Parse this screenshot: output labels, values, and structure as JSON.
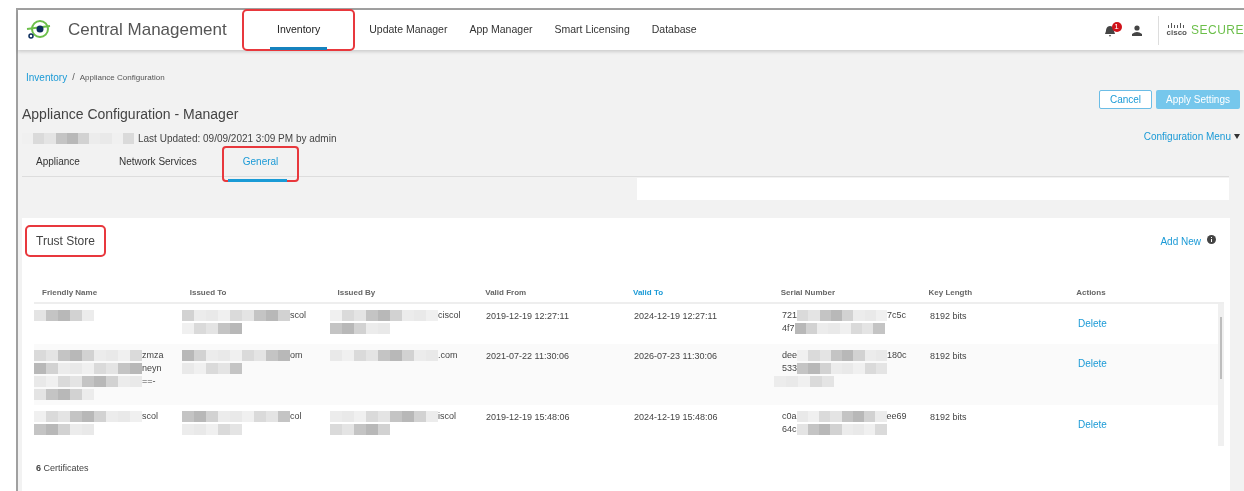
{
  "app": {
    "title": "Central Management",
    "brand_mark": "cisco",
    "brand_name": "SECURE"
  },
  "nav": [
    {
      "label": "Inventory",
      "selected": true,
      "highlighted": true
    },
    {
      "label": "Update Manager",
      "selected": false,
      "highlighted": false
    },
    {
      "label": "App Manager",
      "selected": false,
      "highlighted": false
    },
    {
      "label": "Smart Licensing",
      "selected": false,
      "highlighted": false
    },
    {
      "label": "Database",
      "selected": false,
      "highlighted": false
    }
  ],
  "notifications": {
    "badge": "1"
  },
  "breadcrumb": [
    "Inventory",
    "Appliance Configuration"
  ],
  "breadcrumb_separator": "/",
  "page": {
    "title": "Appliance Configuration - Manager",
    "subtitle": {
      "redacted": true,
      "text": "Last Updated: 09/09/2021 3:09 PM by admin"
    }
  },
  "buttons": {
    "cancel": "Cancel",
    "apply": "Apply Settings",
    "menu": "Configuration Menu"
  },
  "tabs": [
    {
      "label": "Appliance",
      "selected": false,
      "highlighted": false
    },
    {
      "label": "Network Services",
      "selected": false,
      "highlighted": false
    },
    {
      "label": "General",
      "selected": true,
      "highlighted": true
    }
  ],
  "trust_store": {
    "title": "Trust Store",
    "title_highlighted": true,
    "add_new": "Add New",
    "columns": [
      {
        "label": "Friendly Name",
        "sorted": false
      },
      {
        "label": "Issued To",
        "sorted": false
      },
      {
        "label": "Issued By",
        "sorted": false
      },
      {
        "label": "Valid From",
        "sorted": false
      },
      {
        "label": "Valid To",
        "sorted": true
      },
      {
        "label": "Serial Number",
        "sorted": false
      },
      {
        "label": "Key Length",
        "sorted": false
      },
      {
        "label": "Actions",
        "sorted": false
      }
    ],
    "rows": [
      {
        "cells": [
          {
            "lines": [
              {
                "redacted": true
              }
            ]
          },
          {
            "lines": [
              {
                "redacted": true,
                "after": "scol"
              },
              {
                "redacted": true
              }
            ]
          },
          {
            "lines": [
              {
                "redacted": true,
                "after": "ciscol"
              },
              {
                "redacted": true
              }
            ]
          },
          "2019-12-19 12:27:11",
          "2024-12-19 12:27:11",
          {
            "lines": [
              {
                "before": "721",
                "redacted": true,
                "after": "7c5c"
              },
              {
                "before": "4f7",
                "redacted": true
              }
            ]
          },
          "8192 bits"
        ],
        "action": "Delete"
      },
      {
        "cells": [
          {
            "lines": [
              {
                "redacted": true,
                "after": "zmza"
              },
              {
                "redacted": true,
                "after": "neyn"
              },
              {
                "redacted": true,
                "after": "==-"
              },
              {
                "redacted": true
              }
            ]
          },
          {
            "lines": [
              {
                "redacted": true,
                "after": "om"
              },
              {
                "redacted": true
              }
            ]
          },
          {
            "lines": [
              {
                "redacted": true,
                "after": ".com"
              }
            ]
          },
          "2021-07-22 11:30:06",
          "2026-07-23 11:30:06",
          {
            "lines": [
              {
                "before": "dee",
                "redacted": true,
                "after": "180c"
              },
              {
                "before": "533",
                "redacted": true
              },
              {
                "redacted": true
              }
            ]
          },
          "8192 bits"
        ],
        "action": "Delete"
      },
      {
        "cells": [
          {
            "lines": [
              {
                "redacted": true,
                "after": "scol"
              },
              {
                "redacted": true
              }
            ]
          },
          {
            "lines": [
              {
                "redacted": true,
                "after": "col"
              },
              {
                "redacted": true
              }
            ]
          },
          {
            "lines": [
              {
                "redacted": true,
                "after": "iscol"
              },
              {
                "redacted": true
              }
            ]
          },
          "2019-12-19 15:48:06",
          "2024-12-19 15:48:06",
          {
            "lines": [
              {
                "before": "c0a",
                "redacted": true,
                "after": "ee69"
              },
              {
                "before": "64c",
                "redacted": true
              }
            ]
          },
          "8192 bits"
        ],
        "action": "Delete"
      }
    ],
    "footer_count": "6",
    "footer_label": "Certificates"
  }
}
